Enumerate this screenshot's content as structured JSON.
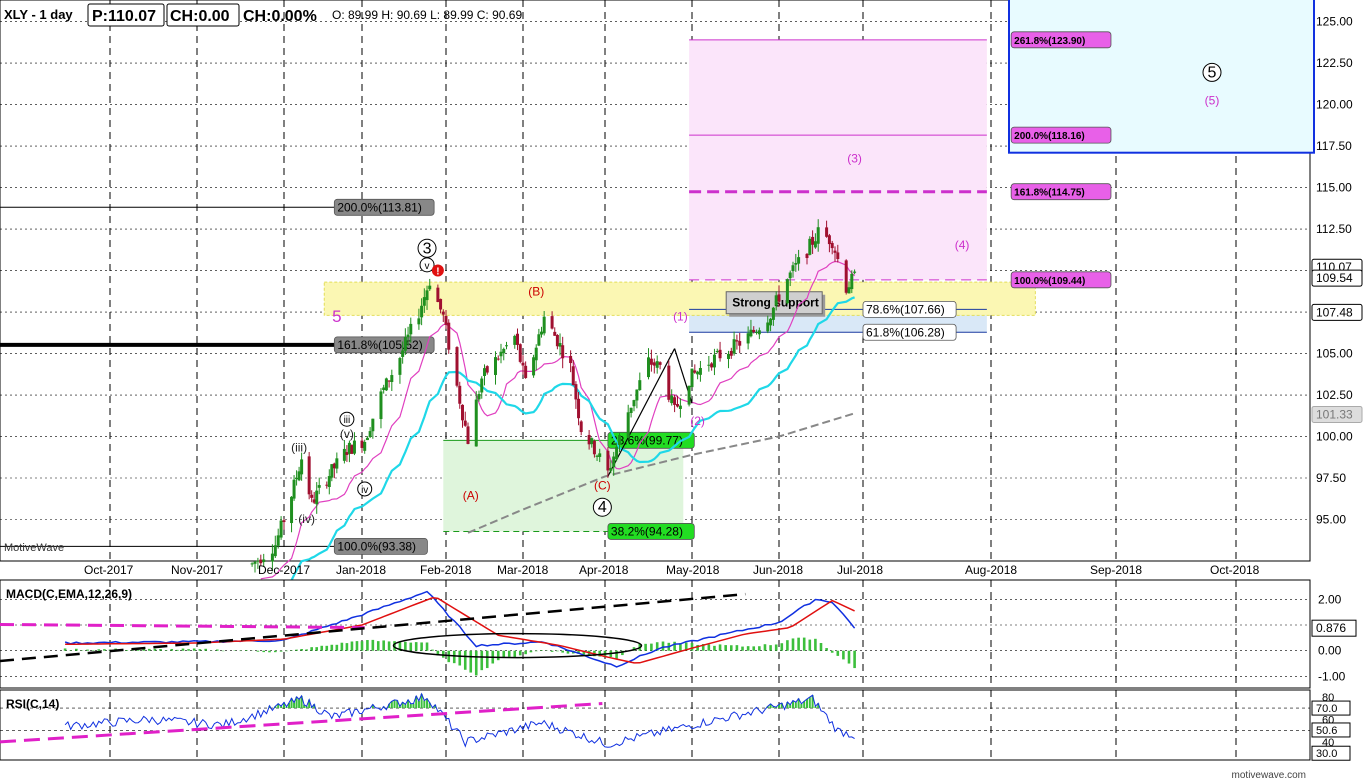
{
  "header": {
    "symbol": "XLY - 1 day",
    "price": "P:110.07",
    "change": "CH:0.00",
    "change_pct": "CH:0.00%",
    "ohlc": "O: 89.99  H: 90.69  L: 89.99  C: 90.69"
  },
  "watermark_left": "MotiveWave",
  "watermark_right": "motivewave.com",
  "colors": {
    "up": "#1f8f1f",
    "down": "#a01030",
    "ma_fast": "#e040c0",
    "ma_mid": "#1fd8e8",
    "ma_slow": "#888888",
    "macd": "#1030e0",
    "signal": "#e01010",
    "rsi": "#1030e0",
    "hist": "#3cbf3c",
    "fib_pink": "#cc30cc",
    "target_box": "#1030e0"
  },
  "chart_data": [
    {
      "type": "candlestick",
      "title": "XLY - 1 day",
      "x_labels": [
        "Oct-2017",
        "Nov-2017",
        "Dec-2017",
        "Jan-2018",
        "Feb-2018",
        "Mar-2018",
        "Apr-2018",
        "May-2018",
        "Jun-2018",
        "Jul-2018",
        "Aug-2018",
        "Sep-2018",
        "Oct-2018"
      ],
      "ylim": [
        92.5,
        126.3
      ],
      "y_ticks": [
        95.0,
        97.5,
        100.0,
        102.5,
        105.0,
        107.5,
        110.0,
        112.5,
        115.0,
        117.5,
        120.0,
        122.5,
        125.0
      ],
      "price_tags": [
        "110.07",
        "109.54",
        "107.48",
        "101.33"
      ],
      "wave_labels": [
        {
          "text": "(iii)",
          "date": "2017-12-07",
          "price": 99.1,
          "color": "#222222"
        },
        {
          "text": "(iv)",
          "date": "2017-12-10",
          "price": 94.8,
          "color": "#222222"
        },
        {
          "text": "(v)",
          "date": "2017-12-26",
          "price": 99.9,
          "color": "#222222"
        },
        {
          "text": "iii",
          "date": "2017-12-26",
          "price": 100.8,
          "color": "#000000",
          "circled": true
        },
        {
          "text": "iv",
          "date": "2018-01-02",
          "price": 96.6,
          "color": "#000000",
          "circled": true
        },
        {
          "text": "v",
          "date": "2018-01-25",
          "price": 110.1,
          "color": "#000000",
          "circled": true
        },
        {
          "text": "3",
          "date": "2018-01-25",
          "price": 111.1,
          "color": "#000000",
          "circled": true
        },
        {
          "text": "5",
          "date": "2017-12-22",
          "price": 106.9,
          "color": "#cc30cc"
        },
        {
          "text": "(A)",
          "date": "2018-02-10",
          "price": 96.2,
          "color": "#cc0000"
        },
        {
          "text": "(B)",
          "date": "2018-03-06",
          "price": 108.5,
          "color": "#cc0000"
        },
        {
          "text": "(C)",
          "date": "2018-03-31",
          "price": 96.8,
          "color": "#cc0000"
        },
        {
          "text": "4",
          "date": "2018-03-31",
          "price": 95.5,
          "color": "#000000",
          "circled": true
        },
        {
          "text": "(1)",
          "date": "2018-04-27",
          "price": 107.0,
          "color": "#cc30cc"
        },
        {
          "text": "(2)",
          "date": "2018-05-03",
          "price": 100.7,
          "color": "#cc30cc"
        },
        {
          "text": "(3)",
          "date": "2018-06-28",
          "price": 116.5,
          "color": "#cc30cc"
        },
        {
          "text": "(4)",
          "date": "2018-07-25",
          "price": 111.3,
          "color": "#cc30cc"
        },
        {
          "text": "5",
          "date": "2018-09-25",
          "price": 121.7,
          "color": "#000000",
          "circled": true
        },
        {
          "text": "(5)",
          "date": "2018-09-25",
          "price": 120.0,
          "color": "#cc30cc"
        }
      ],
      "fib_levels": [
        {
          "label": "200.0%(113.81)",
          "price": 113.81,
          "style": "grey"
        },
        {
          "label": "161.8%(105.52)",
          "price": 105.52,
          "style": "grey-bold"
        },
        {
          "label": "100.0%(93.38)",
          "price": 93.38,
          "style": "grey"
        },
        {
          "label": "23.6%(99.77)",
          "price": 99.77,
          "style": "green"
        },
        {
          "label": "38.2%(94.28)",
          "price": 94.28,
          "style": "green"
        },
        {
          "label": "78.6%(107.66)",
          "price": 107.66,
          "style": "blue"
        },
        {
          "label": "61.8%(106.28)",
          "price": 106.28,
          "style": "blue"
        },
        {
          "label": "100.0%(109.44)",
          "price": 109.44,
          "style": "pink"
        },
        {
          "label": "161.8%(114.75)",
          "price": 114.75,
          "style": "pink-bold"
        },
        {
          "label": "200.0%(118.16)",
          "price": 118.16,
          "style": "pink"
        },
        {
          "label": "261.8%(123.90)",
          "price": 123.9,
          "style": "pink"
        }
      ],
      "annotation": "Strong support"
    },
    {
      "type": "line",
      "title": "MACD(C,EMA,12,26,9)",
      "ylim": [
        -1.45,
        2.75
      ],
      "y_ticks": [
        -1.0,
        0.0,
        1.0,
        2.0
      ],
      "price_tag": "0.876"
    },
    {
      "type": "line",
      "title": "RSI(C,14)",
      "ylim": [
        24,
        86
      ],
      "y_ticks": [
        30.0,
        40.0,
        50.0,
        60.0,
        70.0,
        80.0
      ],
      "price_tags": [
        "70.0",
        "50.6",
        "30.0"
      ]
    }
  ]
}
